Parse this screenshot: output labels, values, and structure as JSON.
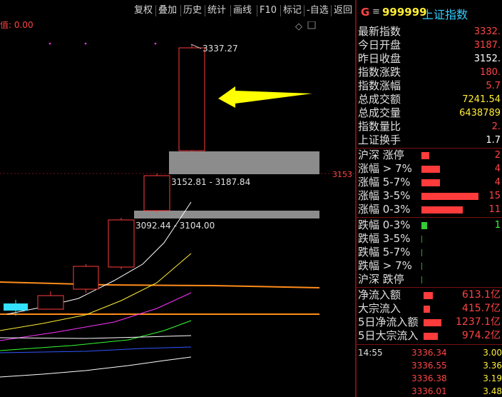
{
  "toolbar": {
    "buttons": [
      "复权",
      "叠加",
      "历史",
      "统计",
      "画线",
      "F10",
      "标记",
      "-自选",
      "返回"
    ]
  },
  "chart": {
    "indicator_label": "值: 0.00",
    "diamond_icon": "diamond-icon",
    "price_label_right": "3153",
    "annotations": {
      "high": "3337.27",
      "gap_upper": "3152.81 - 3187.84",
      "gap_lower": "3092.44 - 3104.00"
    },
    "colors": {
      "up": "#ff3b3b",
      "ma_white": "#ffffff",
      "ma_yellow": "#ffee33",
      "ma_magenta": "#ff33ff",
      "ma_green": "#33ff33",
      "ma_blue": "#3355ff",
      "orange": "#ff8c1a",
      "gap": "#8c8c8c",
      "arrow": "#ffff00",
      "cyan": "#33e0ff"
    }
  },
  "panel": {
    "header": {
      "g_label": "G",
      "menu_icon": "menu-icon",
      "code": "999999",
      "name": "上证指数"
    },
    "stats": [
      {
        "label": "最新指数",
        "value": "3332.",
        "color": "#ff4444"
      },
      {
        "label": "今日开盘",
        "value": "3187.",
        "color": "#ff4444"
      },
      {
        "label": "昨日收盘",
        "value": "3152.",
        "color": "#ffffff"
      },
      {
        "label": "指数涨跌",
        "value": "180.",
        "color": "#ff4444"
      },
      {
        "label": "指数涨幅",
        "value": "5.7",
        "color": "#ff4444"
      },
      {
        "label": "总成交额",
        "value": "7241.54",
        "color": "#ffee33"
      },
      {
        "label": "总成交量",
        "value": "6438789",
        "color": "#ffee33"
      },
      {
        "label": "指数量比",
        "value": "2.",
        "color": "#ff4444"
      },
      {
        "label": "上证换手",
        "value": "1.7",
        "color": "#ffffff"
      }
    ],
    "rise_dist": [
      {
        "label": "沪深 涨停",
        "value": "2",
        "bar": 0.14
      },
      {
        "label": "涨幅 > 7%",
        "value": "4",
        "bar": 0.32
      },
      {
        "label": "涨幅 5-7%",
        "value": "4",
        "bar": 0.32
      },
      {
        "label": "涨幅 3-5%",
        "value": "15",
        "bar": 1.0
      },
      {
        "label": "涨幅 0-3%",
        "value": "11",
        "bar": 0.72
      }
    ],
    "fall_dist": [
      {
        "label": "跌幅 0-3%",
        "value": "1",
        "bar": 0.1
      },
      {
        "label": "跌幅 3-5%",
        "value": "",
        "bar": 0.0
      },
      {
        "label": "跌幅 5-7%",
        "value": "",
        "bar": 0.0
      },
      {
        "label": "跌幅 > 7%",
        "value": "",
        "bar": 0.0
      },
      {
        "label": "沪深 跌停",
        "value": "",
        "bar": 0.0
      }
    ],
    "flows": [
      {
        "label": "净流入额",
        "value": "613.1亿",
        "bar": 0.5
      },
      {
        "label": "大宗流入",
        "value": "415.7亿",
        "bar": 0.34
      },
      {
        "label": "5日净流入额",
        "value": "1237.1亿",
        "bar": 1.0
      },
      {
        "label": "5日大宗流入",
        "value": "974.2亿",
        "bar": 0.8
      }
    ],
    "ticks": [
      {
        "time": "14:55",
        "price": "3336.34",
        "vol": "3.00"
      },
      {
        "time": "",
        "price": "3336.55",
        "vol": "3.36"
      },
      {
        "time": "",
        "price": "3336.38",
        "vol": "3.19"
      },
      {
        "time": "",
        "price": "3336.01",
        "vol": "3.48"
      }
    ]
  }
}
